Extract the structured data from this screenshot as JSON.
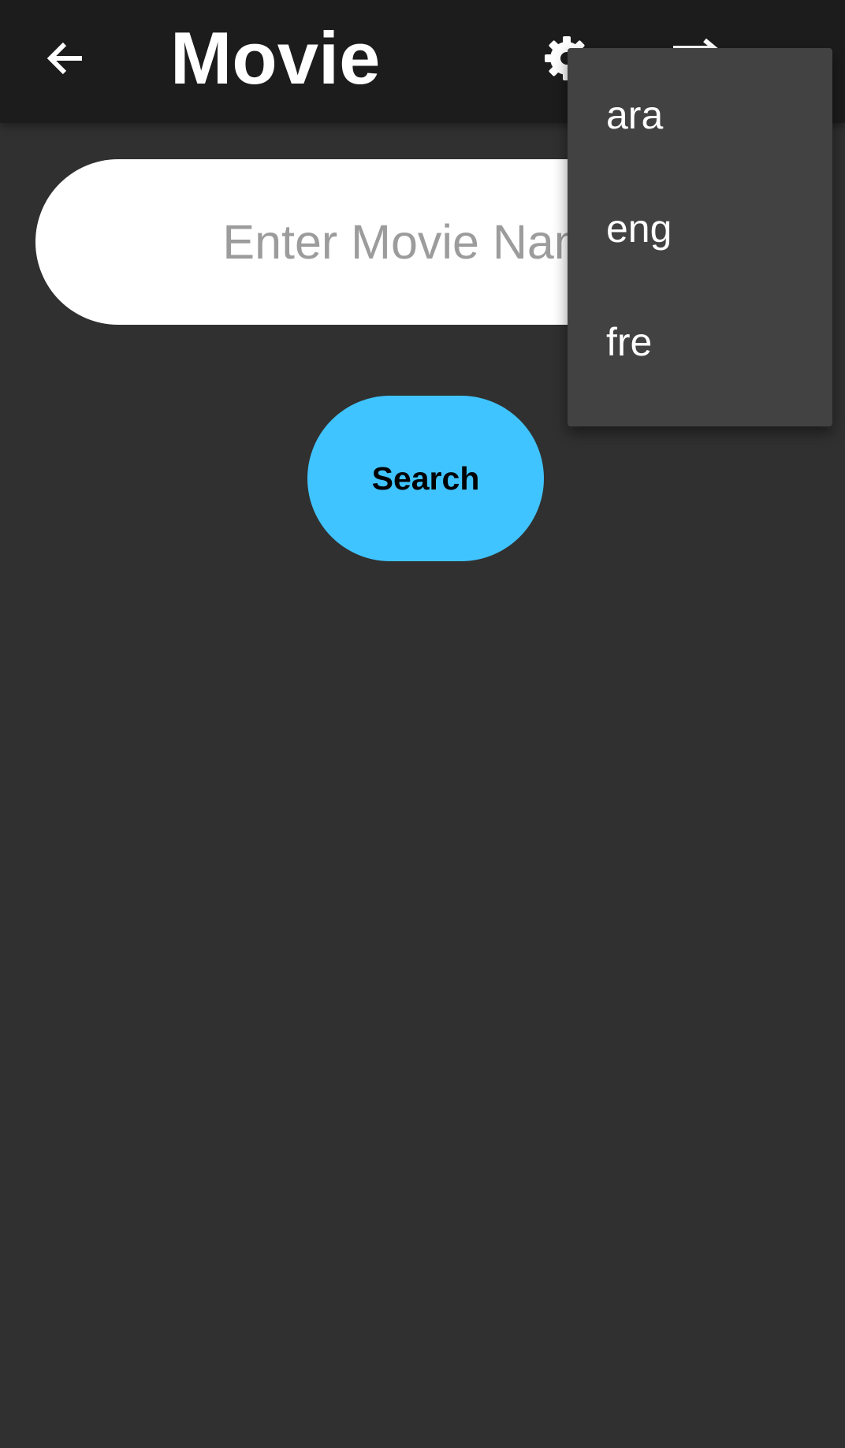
{
  "app_bar": {
    "title": "Movie",
    "back_icon": "arrow-back-icon",
    "settings_icon": "gear-icon",
    "logout_icon": "logout-icon"
  },
  "search": {
    "placeholder": "Enter Movie Name",
    "value": "",
    "button_label": "Search"
  },
  "language_menu": {
    "items": [
      {
        "label": "ara"
      },
      {
        "label": "eng"
      },
      {
        "label": "fre"
      }
    ]
  },
  "colors": {
    "background": "#303030",
    "app_bar": "#1c1c1d",
    "accent": "#40c4ff",
    "menu_background": "#424242",
    "input_background": "#ffffff",
    "placeholder": "#9c9c9c"
  }
}
